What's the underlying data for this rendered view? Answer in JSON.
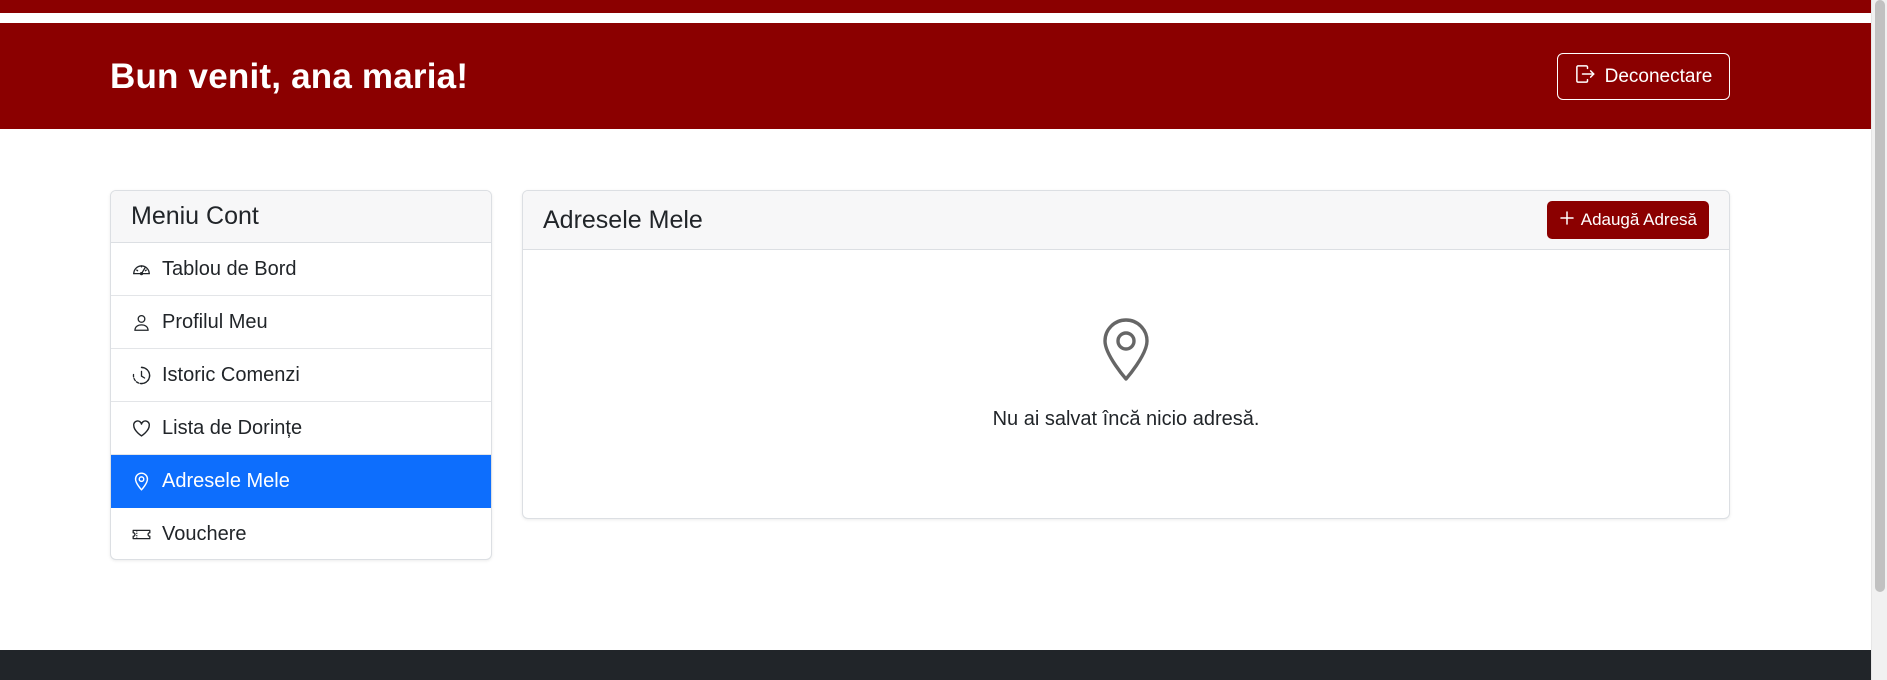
{
  "header": {
    "title": "Bun venit, ana maria!",
    "logout_label": "Deconectare",
    "background": "#8b0000"
  },
  "sidebar": {
    "title": "Meniu Cont",
    "items": [
      {
        "label": "Tablou de Bord",
        "icon": "speedometer-icon"
      },
      {
        "label": "Profilul Meu",
        "icon": "person-icon"
      },
      {
        "label": "Istoric Comenzi",
        "icon": "clock-history-icon"
      },
      {
        "label": "Lista de Dorințe",
        "icon": "heart-icon"
      },
      {
        "label": "Adresele Mele",
        "icon": "geo-alt-icon",
        "active": true
      },
      {
        "label": "Vouchere",
        "icon": "ticket-icon"
      }
    ],
    "active_color": "#0d6efd"
  },
  "main": {
    "title": "Adresele Mele",
    "add_button_label": "Adaugă Adresă",
    "empty_icon": "geo-alt-icon",
    "empty_text": "Nu ai salvat încă nicio adresă."
  }
}
